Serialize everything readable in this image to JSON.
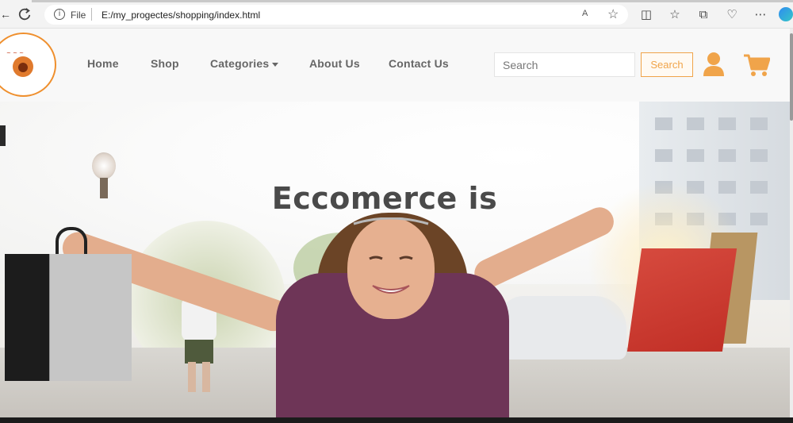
{
  "browser": {
    "file_label": "File",
    "url": "E:/my_progectes/shopping/index.html",
    "read_aloud_label": "A",
    "icons": [
      "back-icon",
      "reload-icon",
      "info-icon",
      "read-aloud-icon",
      "favorite-star-icon",
      "split-screen-icon",
      "favorites-icon",
      "collections-icon",
      "extensions-icon",
      "more-icon",
      "copilot-icon"
    ]
  },
  "nav": {
    "links": [
      "Home",
      "Shop",
      "Categories",
      "About Us",
      "Contact Us"
    ],
    "search": {
      "placeholder": "Search",
      "button_label": "Search"
    },
    "icons": [
      "logo",
      "user-icon",
      "cart-icon"
    ]
  },
  "hero": {
    "headline": "Eccomerce is"
  },
  "colors": {
    "accent": "#f0a44a",
    "logo_ring": "#ef8f2d",
    "nav_text": "#666666",
    "headline": "#4a4a4a"
  }
}
